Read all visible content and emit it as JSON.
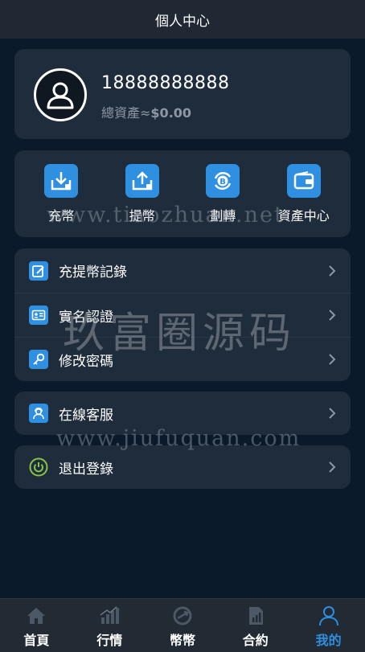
{
  "header": {
    "title": "個人中心"
  },
  "profile": {
    "phone": "18888888888",
    "assets_label": "總資產≈",
    "assets_value": "$0.00"
  },
  "actions": [
    {
      "label": "充幣",
      "icon": "deposit-icon"
    },
    {
      "label": "提幣",
      "icon": "withdraw-icon"
    },
    {
      "label": "劃轉",
      "icon": "transfer-icon"
    },
    {
      "label": "資產中心",
      "icon": "wallet-icon"
    }
  ],
  "menu": [
    {
      "label": "充提幣記錄",
      "icon": "edit-record-icon"
    },
    {
      "label": "實名認證",
      "icon": "id-card-icon"
    },
    {
      "label": "修改密碼",
      "icon": "key-icon"
    }
  ],
  "service": {
    "label": "在線客服",
    "icon": "customer-service-icon"
  },
  "logout": {
    "label": "退出登錄",
    "icon": "power-icon"
  },
  "watermarks": {
    "line1": "www.tiaozhuan.net",
    "line2": "玖富圈源码",
    "line3": "www.jiufuquan.com"
  },
  "tabs": [
    {
      "label": "首頁",
      "icon": "home-icon",
      "active": false
    },
    {
      "label": "行情",
      "icon": "market-icon",
      "active": false
    },
    {
      "label": "幣幣",
      "icon": "exchange-icon",
      "active": false
    },
    {
      "label": "合約",
      "icon": "contract-icon",
      "active": false
    },
    {
      "label": "我的",
      "icon": "user-icon",
      "active": true
    }
  ],
  "colors": {
    "background": "#0b1a2a",
    "card": "#1f2c3b",
    "accent": "#2f8fe0",
    "header": "#202833",
    "tabbar": "#222a34",
    "muted_text": "#8e98a4",
    "power_icon": "#8bc34a"
  }
}
